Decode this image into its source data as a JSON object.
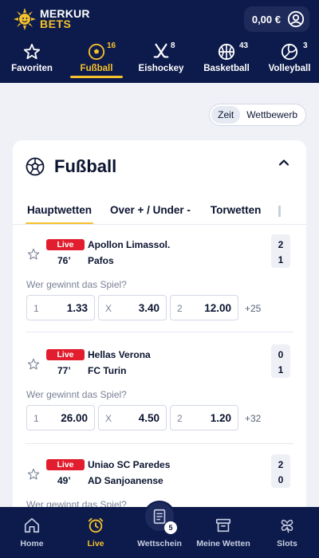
{
  "header": {
    "logo_top": "MERKUR",
    "logo_bottom": "BETS",
    "balance": "0,00 €",
    "icons": {
      "account": "user-circle-icon",
      "logo": "sun-icon"
    }
  },
  "sports_nav": [
    {
      "label": "Favoriten",
      "count": "",
      "icon": "star-icon"
    },
    {
      "label": "Fußball",
      "count": "16",
      "icon": "soccer-ball-icon",
      "active": true
    },
    {
      "label": "Eishockey",
      "count": "8",
      "icon": "hockey-sticks-icon"
    },
    {
      "label": "Basketball",
      "count": "43",
      "icon": "basketball-icon"
    },
    {
      "label": "Volleyball",
      "count": "3",
      "icon": "volleyball-icon"
    }
  ],
  "sort": {
    "option_time": "Zeit",
    "option_competition": "Wettbewerb",
    "selected": "Zeit"
  },
  "card": {
    "title": "Fußball",
    "market_tabs": [
      "Hauptwetten",
      "Over + / Under -",
      "Torwetten"
    ],
    "active_market": "Hauptwetten"
  },
  "matches": [
    {
      "live_label": "Live",
      "minute": "76’",
      "home": "Apollon Limassol.",
      "away": "Pafos",
      "score_home": "2",
      "score_away": "1",
      "question": "Wer gewinnt das Spiel?",
      "odds": [
        {
          "key": "1",
          "value": "1.33"
        },
        {
          "key": "X",
          "value": "3.40"
        },
        {
          "key": "2",
          "value": "12.00"
        }
      ],
      "more": "+25"
    },
    {
      "live_label": "Live",
      "minute": "77’",
      "home": "Hellas Verona",
      "away": "FC Turin",
      "score_home": "0",
      "score_away": "1",
      "question": "Wer gewinnt das Spiel?",
      "odds": [
        {
          "key": "1",
          "value": "26.00"
        },
        {
          "key": "X",
          "value": "4.50"
        },
        {
          "key": "2",
          "value": "1.20"
        }
      ],
      "more": "+32"
    },
    {
      "live_label": "Live",
      "minute": "49’",
      "home": "Uniao SC Paredes",
      "away": "AD Sanjoanense",
      "score_home": "2",
      "score_away": "0",
      "question": "Wer gewinnt das Spiel?"
    }
  ],
  "bottom_nav": [
    {
      "label": "Home",
      "icon": "home-icon"
    },
    {
      "label": "Live",
      "icon": "alarm-clock-icon",
      "active": true
    },
    {
      "label": "Wettschein",
      "icon": "betslip-icon",
      "badge": "5"
    },
    {
      "label": "Meine Wetten",
      "icon": "archive-box-icon"
    },
    {
      "label": "Slots",
      "icon": "clover-icon"
    }
  ],
  "colors": {
    "navy": "#0d1b4c",
    "accent": "#f5c12b",
    "live": "#e11d2e",
    "background": "#eff1f7"
  }
}
